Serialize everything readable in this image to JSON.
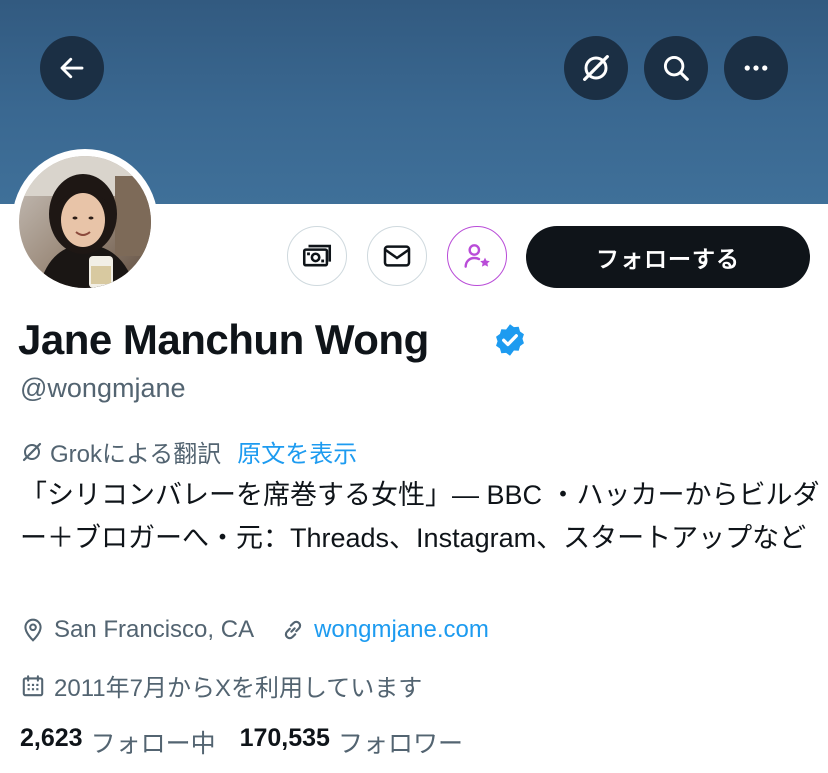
{
  "header": {
    "back_icon": "arrow-left-icon",
    "grok_icon": "grok-icon",
    "search_icon": "search-icon",
    "more_icon": "more-icon",
    "banner_color": "#3a6891"
  },
  "actions": {
    "subscribe_icon": "money-icon",
    "message_icon": "mail-icon",
    "subscription_icon": "person-star-icon",
    "follow_label": "フォローする"
  },
  "profile": {
    "name": "Jane Manchun Wong",
    "verified": true,
    "handle": "@wongmjane",
    "translation_note": "Grokによる翻訳",
    "show_original": "原文を表示",
    "bio": "「シリコンバレーを席巻する女性」— BBC ・ハッカーからビルダー＋ブロガーへ・元：Threads、Instagram、スタートアップなど",
    "location": "San Francisco, CA",
    "website": "wongmjane.com",
    "joined": "2011年7月からXを利用しています"
  },
  "stats": {
    "following_count": "2,623",
    "following_label": "フォロー中",
    "followers_count": "170,535",
    "followers_label": "フォロワー"
  },
  "colors": {
    "accent": "#1d9bf0",
    "follow_button": "#0f1419",
    "subscription_ring": "#b94cd8"
  }
}
